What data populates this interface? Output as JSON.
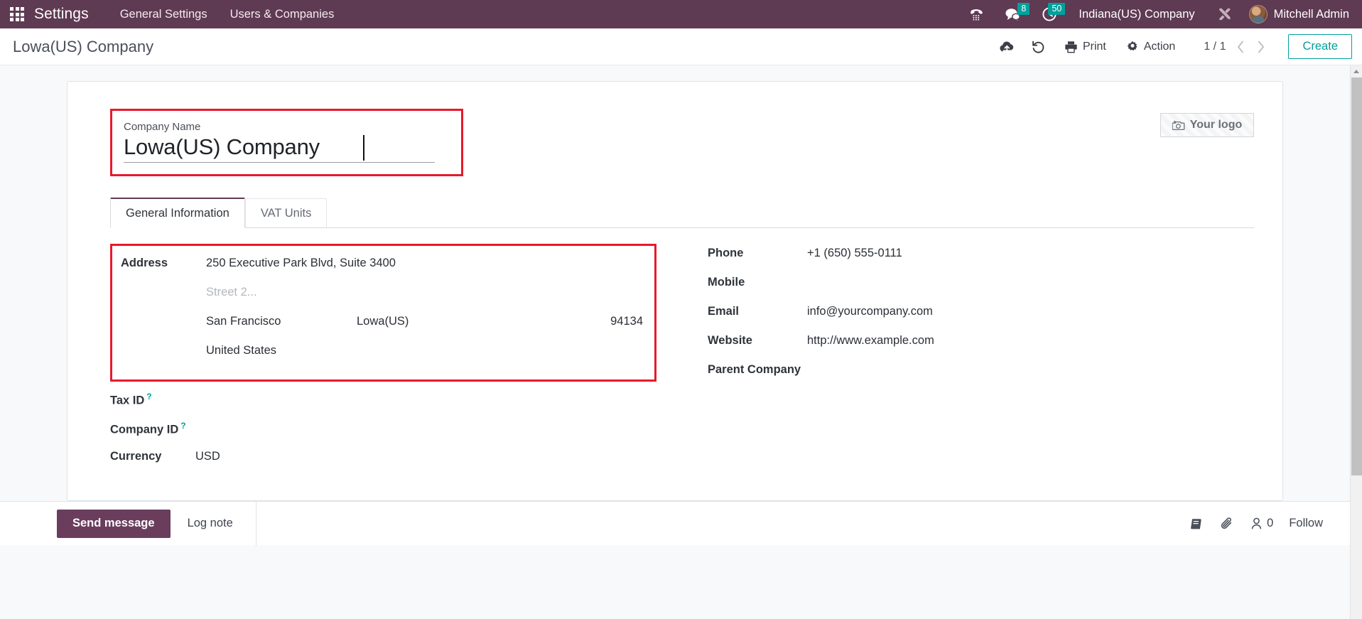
{
  "topbar": {
    "apps_icon": "apps-grid-icon",
    "app_title": "Settings",
    "menus": [
      {
        "label": "General Settings"
      },
      {
        "label": "Users & Companies"
      }
    ],
    "systray": [
      {
        "name": "voip-phone-icon",
        "badge": ""
      },
      {
        "name": "messages-icon",
        "badge": "8"
      },
      {
        "name": "activities-clock-icon",
        "badge": "50"
      }
    ],
    "active_company": "Indiana(US) Company",
    "debug_icon": "tools-debug-icon",
    "user_name": "Mitchell Admin",
    "bg_color": "#5f3a53",
    "badge_color": "#00a09d"
  },
  "controlpanel": {
    "breadcrumb": "Lowa(US) Company",
    "save_icon": "cloud-upload-save-icon",
    "discard_icon": "undo-discard-icon",
    "print_label": "Print",
    "print_icon": "printer-icon",
    "action_label": "Action",
    "action_icon": "gear-icon",
    "pager_value": "1 / 1",
    "prev_icon": "chevron-left-icon",
    "next_icon": "chevron-right-icon",
    "create_label": "Create",
    "accent_color": "#00a09d"
  },
  "sheet": {
    "logo_button": {
      "label": "Your logo",
      "icon": "camera-plus-icon"
    },
    "company_name": {
      "label": "Company Name",
      "value": "Lowa(US) Company"
    },
    "tabs": [
      {
        "label": "General Information",
        "active": true
      },
      {
        "label": "VAT Units",
        "active": false
      }
    ],
    "left_column": {
      "address": {
        "label": "Address",
        "street": "250 Executive Park Blvd, Suite 3400",
        "street2_placeholder": "Street 2...",
        "city": "San Francisco",
        "state": "Lowa(US)",
        "zip": "94134",
        "country": "United States"
      },
      "tax_id": {
        "label": "Tax ID",
        "value": "",
        "help": "?"
      },
      "company_id": {
        "label": "Company ID",
        "value": "",
        "help": "?"
      },
      "currency": {
        "label": "Currency",
        "value": "USD"
      }
    },
    "right_column": {
      "phone": {
        "label": "Phone",
        "value": "+1 (650) 555-0111"
      },
      "mobile": {
        "label": "Mobile",
        "value": ""
      },
      "email": {
        "label": "Email",
        "value": "info@yourcompany.com"
      },
      "website": {
        "label": "Website",
        "value": "http://www.example.com"
      },
      "parent_company": {
        "label": "Parent Company",
        "value": ""
      }
    },
    "highlight_color": "#e8192c"
  },
  "chatter": {
    "send_message_label": "Send message",
    "log_note_label": "Log note",
    "log_icon": "message-log-icon",
    "attachment_icon": "paperclip-icon",
    "followers_icon": "user-follower-icon",
    "followers_count": "0",
    "follow_label": "Follow"
  }
}
